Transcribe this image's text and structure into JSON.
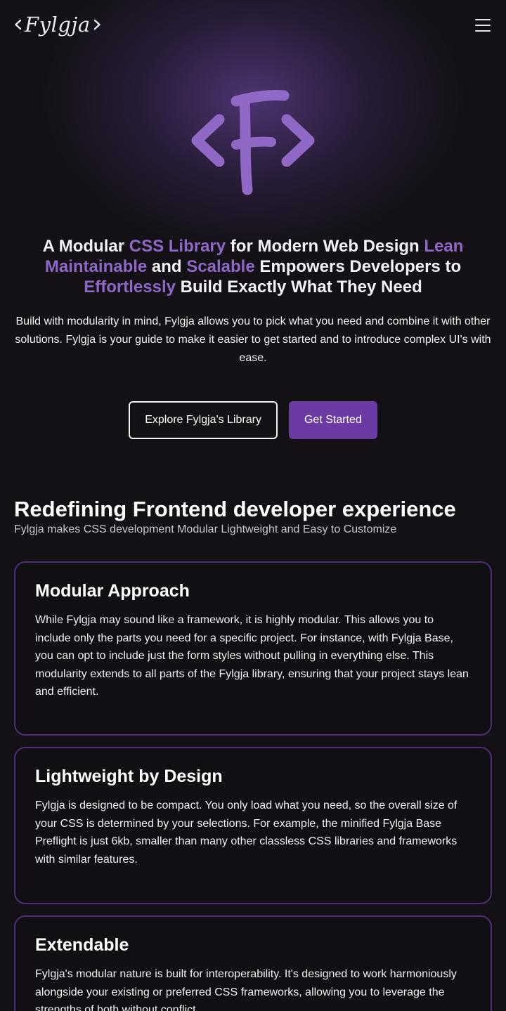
{
  "brand": {
    "name": "Fylgja",
    "accent": "#8f67c7",
    "button_bg": "#6b3aa3",
    "border": "#4e2f75"
  },
  "header": {
    "menu_icon": "hamburger-menu-icon"
  },
  "hero": {
    "title_parts": [
      {
        "text": "A Modular ",
        "highlight": false
      },
      {
        "text": "CSS Library",
        "highlight": true
      },
      {
        "text": " for Modern Web Design ",
        "highlight": false
      },
      {
        "text": "Lean Maintainable",
        "highlight": true
      },
      {
        "text": " and ",
        "highlight": false
      },
      {
        "text": "Scalable",
        "highlight": true
      },
      {
        "text": " Empowers Developers to ",
        "highlight": false
      },
      {
        "text": "Effortlessly",
        "highlight": true
      },
      {
        "text": " Build Exactly What They Need",
        "highlight": false
      }
    ],
    "description": "Build with modularity in mind, Fylgja allows you to pick what you need and combine it with other solutions. Fylgja is your guide to make it easier to get started and to introduce complex UI's with ease.",
    "explore_label": "Explore Fylgja's Library",
    "start_label": "Get Started"
  },
  "features": {
    "title": "Redefining Frontend developer experience",
    "subtitle": "Fylgja makes CSS development Modular Lightweight and Easy to Customize",
    "cards": [
      {
        "title": "Modular Approach",
        "body": "While Fylgja may sound like a framework, it is highly modular. This allows you to include only the parts you need for a specific project. For instance, with Fylgja Base, you can opt to include just the form styles without pulling in everything else. This modularity extends to all parts of the Fylgja library, ensuring that your project stays lean and efficient."
      },
      {
        "title": "Lightweight by Design",
        "body": "Fylgja is designed to be compact. You only load what you need, so the overall size of your CSS is determined by your selections. For example, the minified Fylgja Base Preflight is just 6kb, smaller than many other classless CSS libraries and frameworks with similar features."
      },
      {
        "title": "Extendable",
        "body": "Fylgja's modular nature is built for interoperability. It's designed to work harmoniously alongside your existing or preferred CSS frameworks, allowing you to leverage the strengths of both without conflict."
      }
    ]
  }
}
